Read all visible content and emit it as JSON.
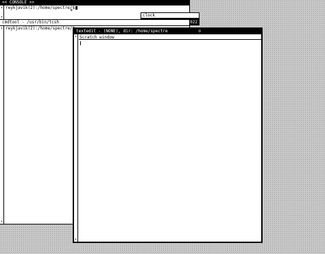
{
  "console": {
    "title": "<< CONSOLE >>",
    "prompt": "reykjavik(2):/home/spectre/$"
  },
  "clock": {
    "title": "clock",
    "time_fragment": "022"
  },
  "cmdtool": {
    "title": "cmdtool - /usr/bin/tcsh",
    "prompt": "reykjavik(2):/home/spectre/$"
  },
  "textedit": {
    "title": "textedit - (NONE), dir: /home/spectre",
    "panel_label": "Scratch window",
    "close_glyph": "⊙"
  },
  "icons": {
    "scroll_up": "scroll-up-arrow-icon",
    "scroll_down": "scroll-down-arrow-icon",
    "mouse_pointer": "pointer-cursor-icon"
  },
  "colors": {
    "desktop": "#c8c8c8",
    "titlebar": "#000000",
    "window": "#ffffff"
  }
}
